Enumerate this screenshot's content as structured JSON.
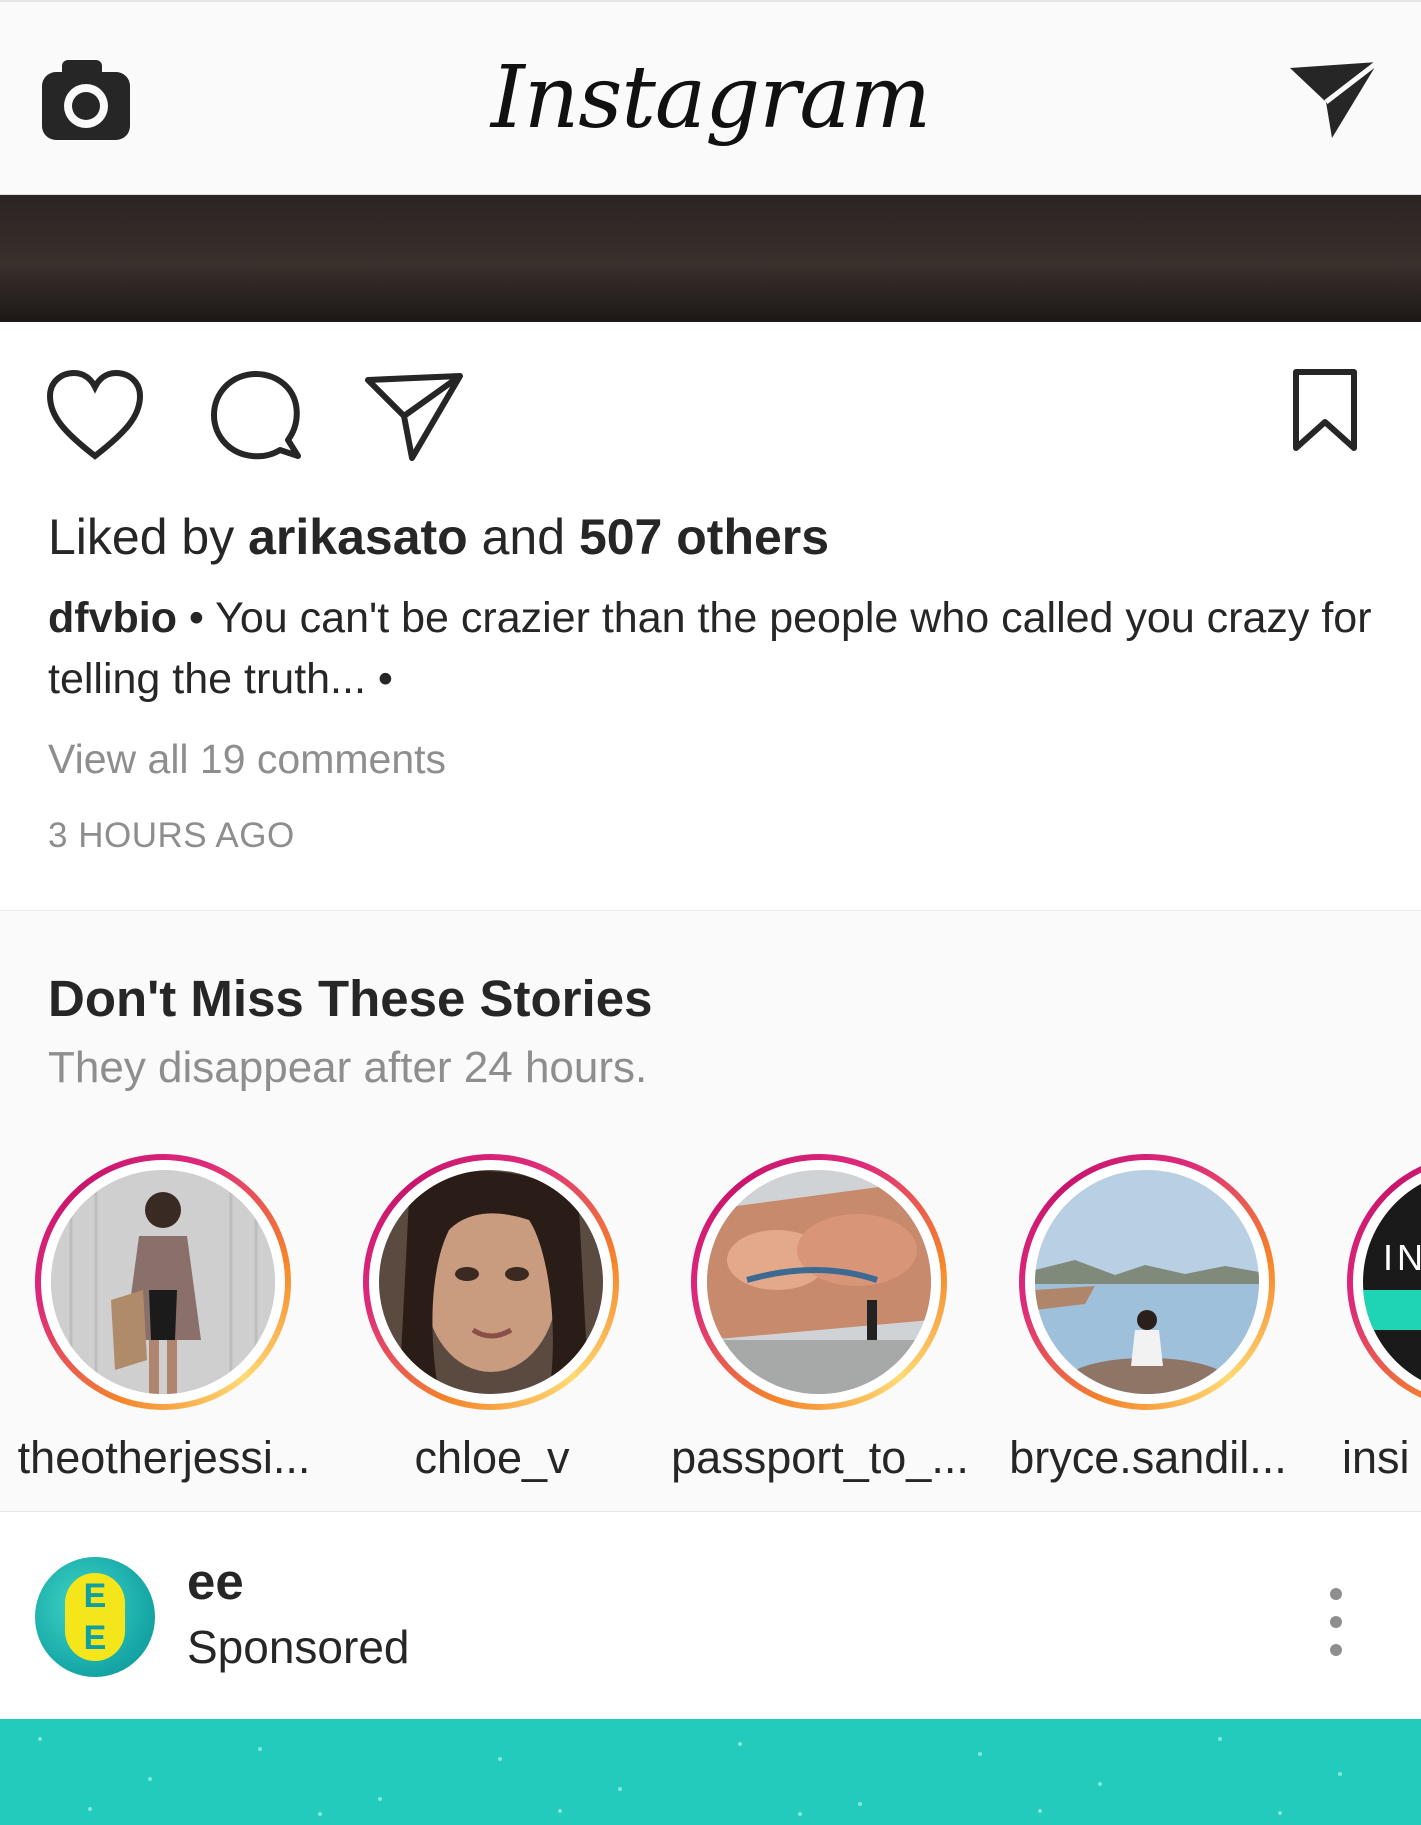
{
  "header": {
    "title": "Instagram",
    "camera_icon": "camera-icon",
    "direct_icon": "paper-plane-icon"
  },
  "post": {
    "likes_prefix": "Liked by ",
    "liked_by_user": "arikasato",
    "likes_and": " and ",
    "likes_others": "507 others",
    "caption_user": "dfvbio",
    "caption_text": " • You can't be crazier than the people who called you crazy for telling the truth... •",
    "view_comments": "View all 19 comments",
    "time_ago": "3 HOURS AGO"
  },
  "stories": {
    "title": "Don't Miss These Stories",
    "subtitle": "They disappear after 24 hours.",
    "items": [
      {
        "username": "theotherjessi..."
      },
      {
        "username": "chloe_v"
      },
      {
        "username": "passport_to_..."
      },
      {
        "username": "bryce.sandil..."
      },
      {
        "username": "insi"
      }
    ]
  },
  "sponsored": {
    "account": "ee",
    "label": "Sponsored",
    "avatar_letters": "E E"
  },
  "colors": {
    "story_ring_start": "#f58529",
    "story_ring_end": "#dd2a7b",
    "ad_teal": "#22cbbb",
    "ee_yellow": "#f4e61a"
  }
}
